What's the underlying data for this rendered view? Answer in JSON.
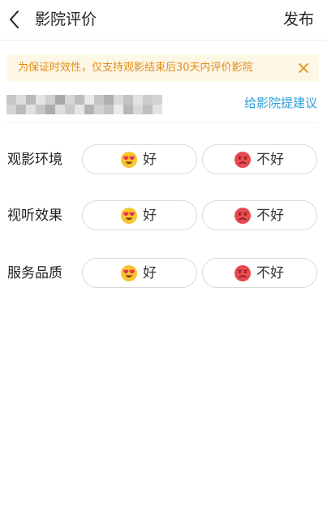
{
  "header": {
    "title": "影院评价",
    "publish_label": "发布"
  },
  "notice": {
    "text": "为保证时效性，仅支持观影结束后30天内评价影院"
  },
  "cinema": {
    "suggest_label": "给影院提建议"
  },
  "ratings": [
    {
      "label": "观影环境",
      "good_label": "好",
      "bad_label": "不好"
    },
    {
      "label": "视听效果",
      "good_label": "好",
      "bad_label": "不好"
    },
    {
      "label": "服务品质",
      "good_label": "好",
      "bad_label": "不好"
    }
  ],
  "colors": {
    "notice_bg": "#fdf7e5",
    "notice_text": "#e48b17",
    "link": "#2e9fd8",
    "good_emoji": "#f7c531",
    "bad_emoji": "#e84a4f"
  },
  "icons": {
    "back": "chevron-left-icon",
    "close": "close-icon",
    "good": "heart-eyes-emoji-icon",
    "bad": "frowning-emoji-icon"
  }
}
